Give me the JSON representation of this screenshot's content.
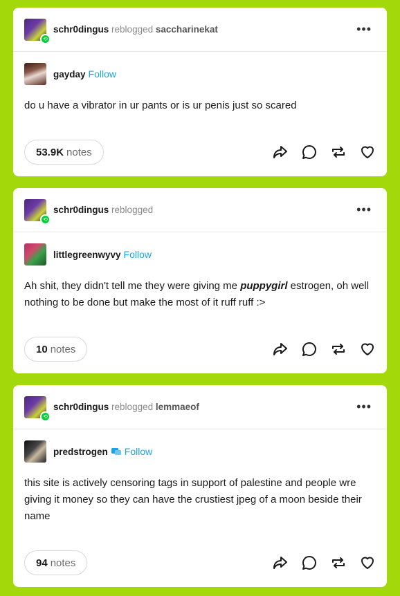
{
  "colors": {
    "background": "#a3d90b",
    "follow": "#1aa3e6",
    "reblog_badge": "#00cf35"
  },
  "posts": [
    {
      "reblogger": "schr0dingus",
      "reblogged_text": "reblogged",
      "source": "saccharinekat",
      "origin_name": "gayday",
      "follow_label": "Follow",
      "body_lines": [
        "do u have a vibrator in ur pants or is ur penis just so scared"
      ],
      "notes_count": "53.9K",
      "notes_label": "notes"
    },
    {
      "reblogger": "schr0dingus",
      "reblogged_text": "reblogged",
      "source": "",
      "origin_name": "littlegreenwyvy",
      "follow_label": "Follow",
      "body_before": "Ah shit, they didn't tell me they were giving me ",
      "body_emph": "puppygirl",
      "body_after": " estrogen, oh well nothing to be done but make the most of it ruff ruff :>",
      "notes_count": "10",
      "notes_label": "notes"
    },
    {
      "reblogger": "schr0dingus",
      "reblogged_text": "reblogged",
      "source": "lemmaeof",
      "origin_name": "predstrogen",
      "follow_label": "Follow",
      "body_lines": [
        "this site is actively censoring tags in support of palestine and people wre giving it money so they can have the crustiest jpeg of a moon beside their name"
      ],
      "notes_count": "94",
      "notes_label": "notes"
    }
  ],
  "icons": [
    "share-icon",
    "reply-icon",
    "reblog-icon",
    "like-icon",
    "more-icon"
  ]
}
